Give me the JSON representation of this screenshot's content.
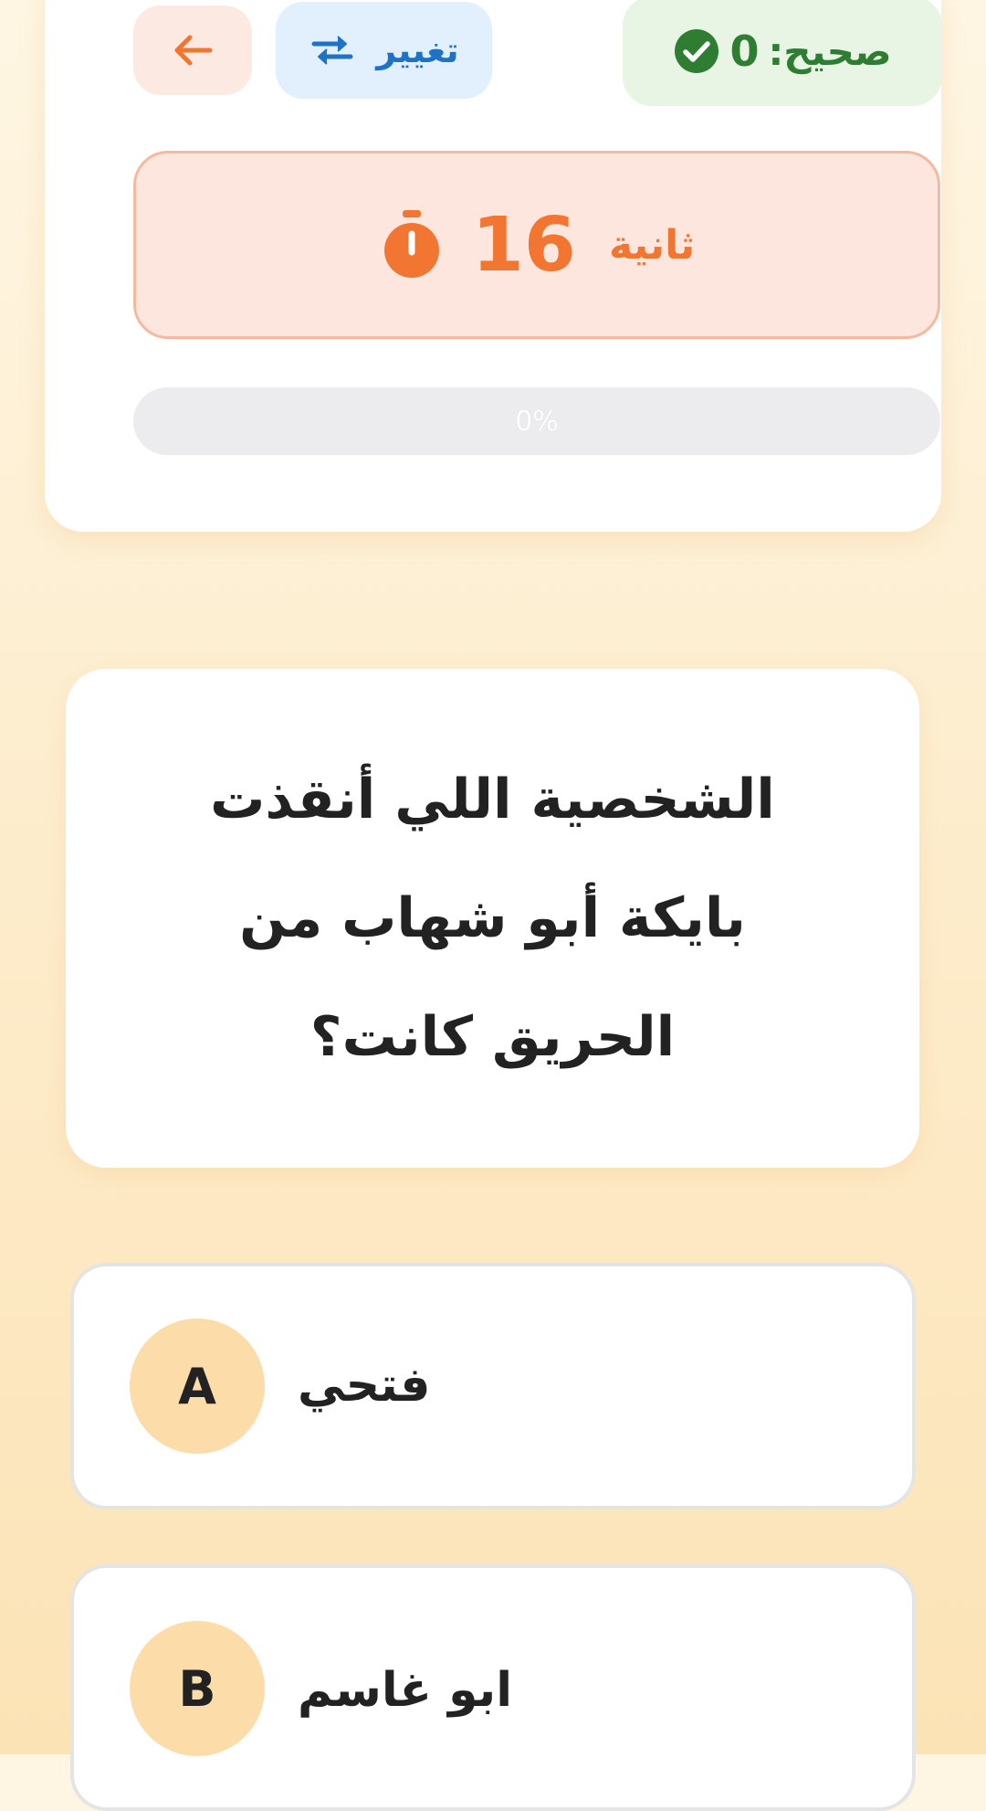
{
  "header": {
    "correct_label": "صحيح:",
    "correct_count": "0",
    "change_label": "تغيير",
    "colors": {
      "correct": "#2E7D32",
      "change": "#1E73C8",
      "accent": "#F27631"
    }
  },
  "timer": {
    "seconds": "16",
    "unit": "ثانية"
  },
  "progress": {
    "value": 0,
    "label": "0%"
  },
  "question": {
    "text": "الشخصية اللي أنقذت بايكة أبو شهاب من الحريق كانت؟"
  },
  "options": [
    {
      "letter": "A",
      "text": "فتحي"
    },
    {
      "letter": "B",
      "text": "ابو غاسم"
    }
  ],
  "icons": [
    "check-circle-icon",
    "swap-icon",
    "back-arrow-icon",
    "stopwatch-icon"
  ]
}
